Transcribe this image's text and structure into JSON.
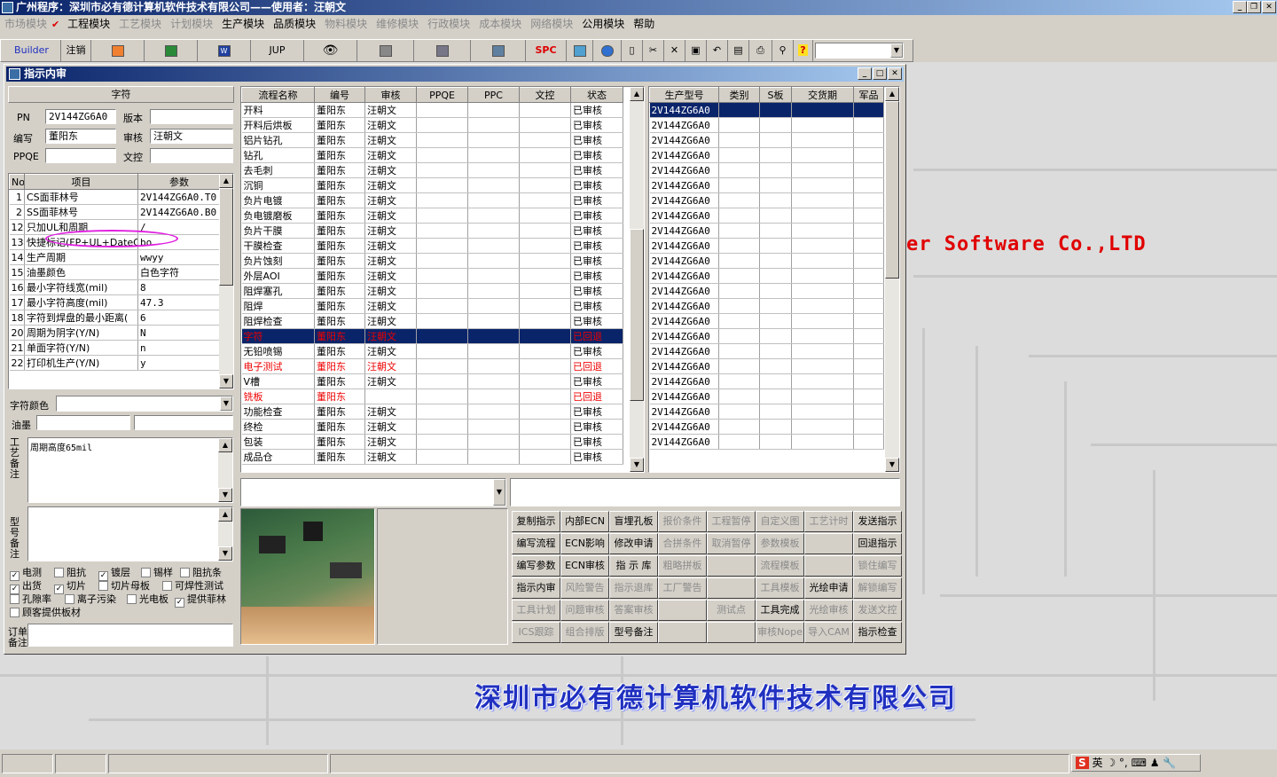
{
  "app": {
    "title": "广州程序：深圳市必有德计算机软件技术有限公司——使用者：汪朝文"
  },
  "menu": [
    {
      "label": "市场模块",
      "enabled": false
    },
    {
      "label": "工程模块",
      "enabled": true,
      "checked": true
    },
    {
      "label": "工艺模块",
      "enabled": false
    },
    {
      "label": "计划模块",
      "enabled": false
    },
    {
      "label": "生产模块",
      "enabled": true
    },
    {
      "label": "品质模块",
      "enabled": true
    },
    {
      "label": "物料模块",
      "enabled": false
    },
    {
      "label": "维修模块",
      "enabled": false
    },
    {
      "label": "行政模块",
      "enabled": false
    },
    {
      "label": "成本模块",
      "enabled": false
    },
    {
      "label": "网络模块",
      "enabled": false
    },
    {
      "label": "公用模块",
      "enabled": true
    },
    {
      "label": "帮助",
      "enabled": true
    }
  ],
  "toolbar": {
    "builder": "Builder",
    "logout": "注销",
    "jup": "JUP",
    "spc": "SPC"
  },
  "desktop": {
    "brand": "er Software Co.,LTD",
    "company": "深圳市必有德计算机软件技术有限公司"
  },
  "dialog": {
    "title": "指示内审",
    "char_header": "字符",
    "pn_label": "PN",
    "pn": "2V144ZG6A0",
    "version_label": "版本",
    "version": "",
    "author_label": "编写",
    "author": "董阳东",
    "review_label": "审核",
    "reviewer": "汪朝文",
    "ppqe_label": "PPQE",
    "ppqe": "",
    "doc_label": "文控",
    "doc": "",
    "param_headers": [
      "No",
      "项目",
      "参数"
    ],
    "params": [
      [
        "1",
        "CS面菲林号",
        "2V144ZG6A0.T0"
      ],
      [
        "2",
        "SS面菲林号",
        "2V144ZG6A0.B0"
      ],
      [
        "12",
        "只加UL和周期",
        "/"
      ],
      [
        "13",
        "快捷标记(FP+UL+DateCo",
        "bo"
      ],
      [
        "14",
        "生产周期",
        "wwyy"
      ],
      [
        "15",
        "油墨颜色",
        "白色字符"
      ],
      [
        "16",
        "最小字符线宽(mil)",
        "8"
      ],
      [
        "17",
        "最小字符高度(mil)",
        "47.3"
      ],
      [
        "18",
        "字符到焊盘的最小距离(",
        "6"
      ],
      [
        "20",
        "周期为阴字(Y/N)",
        "N"
      ],
      [
        "21",
        "单面字符(Y/N)",
        "n"
      ],
      [
        "22",
        "打印机生产(Y/N)",
        "y"
      ]
    ],
    "char_color_label": "字符颜色",
    "ink_label": "油墨",
    "process_note_label": "工艺备注",
    "process_note": "周期高度65mil",
    "model_note_label": "型号备注",
    "order_note_label": "订单备注",
    "checks": [
      {
        "label": "电测",
        "checked": true
      },
      {
        "label": "阻抗",
        "checked": false
      },
      {
        "label": "镀层",
        "checked": true
      },
      {
        "label": "锡样",
        "checked": false
      },
      {
        "label": "阻抗条",
        "checked": false
      },
      {
        "label": "出货",
        "checked": true
      },
      {
        "label": "切片",
        "checked": true
      },
      {
        "label": "切片母板",
        "checked": false
      },
      {
        "label": "可焊性测试",
        "checked": false
      },
      {
        "label": "孔隙率",
        "checked": false
      },
      {
        "label": "离子污染",
        "checked": false
      },
      {
        "label": "光电板",
        "checked": false
      },
      {
        "label": "提供菲林",
        "checked": true
      },
      {
        "label": "顾客提供板材",
        "checked": false
      }
    ],
    "flow_headers": [
      "流程名称",
      "编号",
      "审核",
      "PPQE",
      "PPC",
      "文控",
      "状态"
    ],
    "flow": [
      [
        "开料",
        "董阳东",
        "汪朝文",
        "",
        "",
        "",
        "已审核",
        "n"
      ],
      [
        "开料后烘板",
        "董阳东",
        "汪朝文",
        "",
        "",
        "",
        "已审核",
        "n"
      ],
      [
        "铝片钻孔",
        "董阳东",
        "汪朝文",
        "",
        "",
        "",
        "已审核",
        "n"
      ],
      [
        "钻孔",
        "董阳东",
        "汪朝文",
        "",
        "",
        "",
        "已审核",
        "n"
      ],
      [
        "去毛刺",
        "董阳东",
        "汪朝文",
        "",
        "",
        "",
        "已审核",
        "n"
      ],
      [
        "沉铜",
        "董阳东",
        "汪朝文",
        "",
        "",
        "",
        "已审核",
        "n"
      ],
      [
        "负片电镀",
        "董阳东",
        "汪朝文",
        "",
        "",
        "",
        "已审核",
        "n"
      ],
      [
        "负电镀磨板",
        "董阳东",
        "汪朝文",
        "",
        "",
        "",
        "已审核",
        "n"
      ],
      [
        "负片干膜",
        "董阳东",
        "汪朝文",
        "",
        "",
        "",
        "已审核",
        "n"
      ],
      [
        "干膜检查",
        "董阳东",
        "汪朝文",
        "",
        "",
        "",
        "已审核",
        "n"
      ],
      [
        "负片蚀刻",
        "董阳东",
        "汪朝文",
        "",
        "",
        "",
        "已审核",
        "n"
      ],
      [
        "外层AOI",
        "董阳东",
        "汪朝文",
        "",
        "",
        "",
        "已审核",
        "n"
      ],
      [
        "阻焊塞孔",
        "董阳东",
        "汪朝文",
        "",
        "",
        "",
        "已审核",
        "n"
      ],
      [
        "阻焊",
        "董阳东",
        "汪朝文",
        "",
        "",
        "",
        "已审核",
        "n"
      ],
      [
        "阻焊检查",
        "董阳东",
        "汪朝文",
        "",
        "",
        "",
        "已审核",
        "n"
      ],
      [
        "字符",
        "董阳东",
        "汪朝文",
        "",
        "",
        "",
        "已回退",
        "s"
      ],
      [
        "无铅喷锡",
        "董阳东",
        "汪朝文",
        "",
        "",
        "",
        "已审核",
        "n"
      ],
      [
        "电子测试",
        "董阳东",
        "汪朝文",
        "",
        "",
        "",
        "已回退",
        "r"
      ],
      [
        "V槽",
        "董阳东",
        "汪朝文",
        "",
        "",
        "",
        "已审核",
        "n"
      ],
      [
        "铣板",
        "董阳东",
        "",
        "",
        "",
        "",
        "已回退",
        "r"
      ],
      [
        "功能检查",
        "董阳东",
        "汪朝文",
        "",
        "",
        "",
        "已审核",
        "n"
      ],
      [
        "终检",
        "董阳东",
        "汪朝文",
        "",
        "",
        "",
        "已审核",
        "n"
      ],
      [
        "包装",
        "董阳东",
        "汪朝文",
        "",
        "",
        "",
        "已审核",
        "n"
      ],
      [
        "成品仓",
        "董阳东",
        "汪朝文",
        "",
        "",
        "",
        "已审核",
        "n"
      ]
    ],
    "model_headers": [
      "生产型号",
      "类别",
      "S板",
      "交货期",
      "军品"
    ],
    "models": [
      "2V144ZG6A0",
      "2V144ZG6A0",
      "2V144ZG6A0",
      "2V144ZG6A0",
      "2V144ZG6A0",
      "2V144ZG6A0",
      "2V144ZG6A0",
      "2V144ZG6A0",
      "2V144ZG6A0",
      "2V144ZG6A0",
      "2V144ZG6A0",
      "2V144ZG6A0",
      "2V144ZG6A0",
      "2V144ZG6A0",
      "2V144ZG6A0",
      "2V144ZG6A0",
      "2V144ZG6A0",
      "2V144ZG6A0",
      "2V144ZG6A0",
      "2V144ZG6A0",
      "2V144ZG6A0",
      "2V144ZG6A0",
      "2V144ZG6A0"
    ],
    "buttons": [
      [
        {
          "l": "复制指示",
          "e": true
        },
        {
          "l": "内部ECN",
          "e": true
        },
        {
          "l": "盲埋孔板",
          "e": true
        },
        {
          "l": "报价条件",
          "e": false
        },
        {
          "l": "工程暂停",
          "e": false
        },
        {
          "l": "自定义图",
          "e": false
        },
        {
          "l": "工艺计时",
          "e": false
        },
        {
          "l": "发送指示",
          "e": true
        }
      ],
      [
        {
          "l": "编写流程",
          "e": true
        },
        {
          "l": "ECN影响",
          "e": true
        },
        {
          "l": "修改申请",
          "e": true
        },
        {
          "l": "合拼条件",
          "e": false
        },
        {
          "l": "取消暂停",
          "e": false
        },
        {
          "l": "参数模板",
          "e": false
        },
        {
          "l": "",
          "e": false
        },
        {
          "l": "回退指示",
          "e": true
        }
      ],
      [
        {
          "l": "编写参数",
          "e": true
        },
        {
          "l": "ECN审核",
          "e": true
        },
        {
          "l": "指 示 库",
          "e": true
        },
        {
          "l": "粗略拼板",
          "e": false
        },
        {
          "l": "",
          "e": false
        },
        {
          "l": "流程模板",
          "e": false
        },
        {
          "l": "",
          "e": false
        },
        {
          "l": "锁住编写",
          "e": false
        }
      ],
      [
        {
          "l": "指示内审",
          "e": true
        },
        {
          "l": "风险警告",
          "e": false
        },
        {
          "l": "指示退库",
          "e": false
        },
        {
          "l": "工厂警告",
          "e": false
        },
        {
          "l": "",
          "e": false
        },
        {
          "l": "工具模板",
          "e": false
        },
        {
          "l": "光绘申请",
          "e": true
        },
        {
          "l": "解锁编写",
          "e": false
        }
      ],
      [
        {
          "l": "工具计划",
          "e": false
        },
        {
          "l": "问题审核",
          "e": false
        },
        {
          "l": "答案审核",
          "e": false
        },
        {
          "l": "",
          "e": false
        },
        {
          "l": "测试点",
          "e": false
        },
        {
          "l": "工具完成",
          "e": true
        },
        {
          "l": "光绘审核",
          "e": false
        },
        {
          "l": "发送文控",
          "e": false
        }
      ],
      [
        {
          "l": "ICS跟踪",
          "e": false
        },
        {
          "l": "组合排版",
          "e": false
        },
        {
          "l": "型号备注",
          "e": true
        },
        {
          "l": "",
          "e": false
        },
        {
          "l": "",
          "e": false
        },
        {
          "l": "审核Nope",
          "e": false
        },
        {
          "l": "导入CAM",
          "e": false
        },
        {
          "l": "指示检查",
          "e": true
        }
      ]
    ]
  },
  "tray": {
    "ime": "英"
  }
}
